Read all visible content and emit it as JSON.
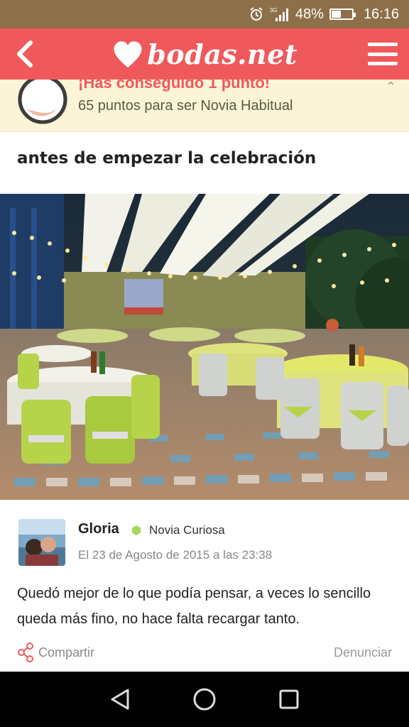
{
  "status_bar": {
    "battery": "48%",
    "battery_level": 0.48,
    "time": "16:16",
    "network": "3G"
  },
  "header": {
    "logo_text": "bodas.net",
    "brand_color": "#f0595b"
  },
  "points_banner": {
    "title": "¡Has conseguido 1 punto!",
    "subtitle": "65 puntos para ser Novia Habitual"
  },
  "post": {
    "title": "antes de empezar la celebración"
  },
  "comment": {
    "author": "Gloria",
    "level": "Novia Curiosa",
    "level_color": "#a5d85f",
    "date": "El 23 de Agosto de 2015 a las 23:38",
    "text": "Quedó mejor de lo que podía pensar, a veces lo sencillo queda más fino, no hace falta recargar tanto."
  },
  "actions": {
    "share_label": "Compartir",
    "report_label": "Denunciar"
  },
  "nav": {
    "back": "back-icon",
    "home": "home-icon",
    "recents": "recents-icon"
  }
}
